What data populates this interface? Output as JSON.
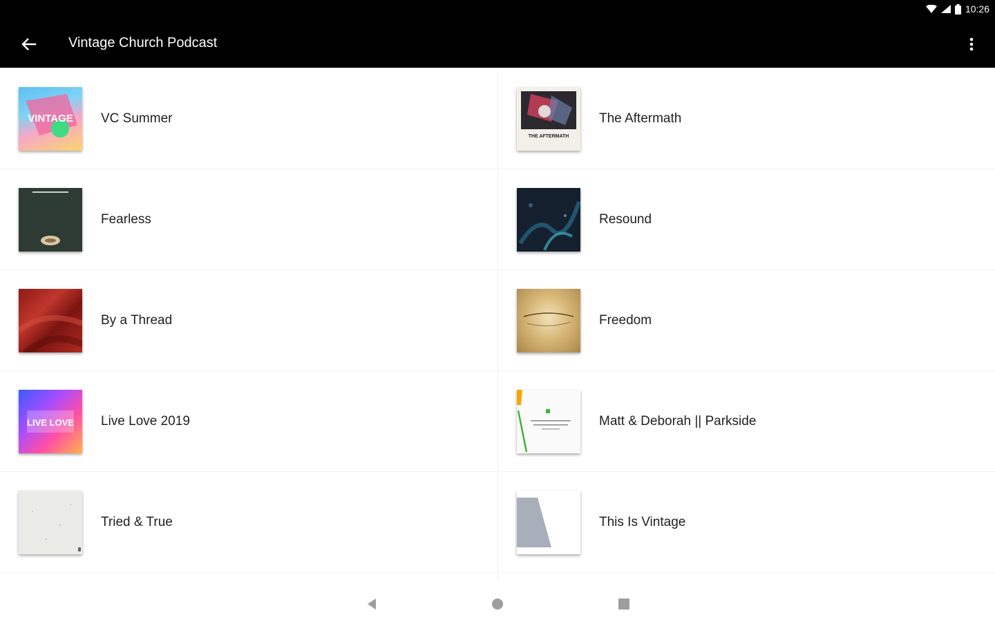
{
  "status": {
    "time": "10:26"
  },
  "appbar": {
    "title": "Vintage Church Podcast"
  },
  "podcasts": [
    {
      "title": "VC Summer"
    },
    {
      "title": "The Aftermath"
    },
    {
      "title": "Fearless"
    },
    {
      "title": "Resound"
    },
    {
      "title": "By a Thread"
    },
    {
      "title": "Freedom"
    },
    {
      "title": "Live Love 2019"
    },
    {
      "title": "Matt & Deborah || Parkside"
    },
    {
      "title": "Tried & True"
    },
    {
      "title": "This Is Vintage"
    }
  ],
  "thumbnail_text": {
    "vc_summer": "VINTAGE",
    "aftermath": "THE AFTERMATH",
    "live_love": "LIVE LOVE"
  },
  "icons": {
    "back": "arrow-back-icon",
    "more": "more-vert-icon",
    "nav_back": "triangle-back-icon",
    "nav_home": "circle-home-icon",
    "nav_recents": "square-recents-icon"
  },
  "colors": {
    "appbar": "#000000",
    "background": "#ffffff",
    "text": "#212121"
  }
}
